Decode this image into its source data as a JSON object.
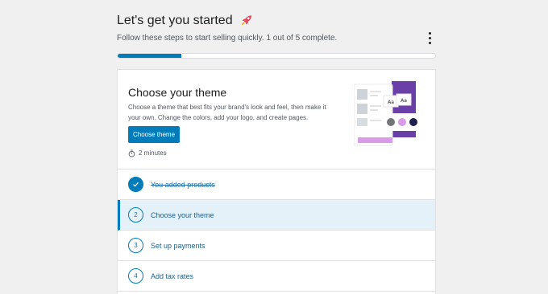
{
  "header": {
    "title": "Let's get you started",
    "subtitle": "Follow these steps to start selling quickly. 1 out of 5 complete.",
    "progress_fraction": 0.2
  },
  "hero": {
    "title": "Choose your theme",
    "description": "Choose a theme that best fits your brand's look and feel, then make it your own. Change the colors, add your logo, and create pages.",
    "button_label": "Choose theme",
    "time_estimate": "2 minutes",
    "illustration_labels": [
      "Aa",
      "Aa"
    ]
  },
  "steps": [
    {
      "number": "",
      "label": "You added products",
      "status": "done"
    },
    {
      "number": "2",
      "label": "Choose your theme",
      "status": "active"
    },
    {
      "number": "3",
      "label": "Set up payments",
      "status": "todo"
    },
    {
      "number": "4",
      "label": "Add tax rates",
      "status": "todo"
    }
  ],
  "colors": {
    "accent": "#007cba",
    "illustration_purple": "#6a3fa8",
    "swatch_gray": "#757575",
    "swatch_pink": "#d99ae8",
    "swatch_navy": "#1f1f4d"
  }
}
